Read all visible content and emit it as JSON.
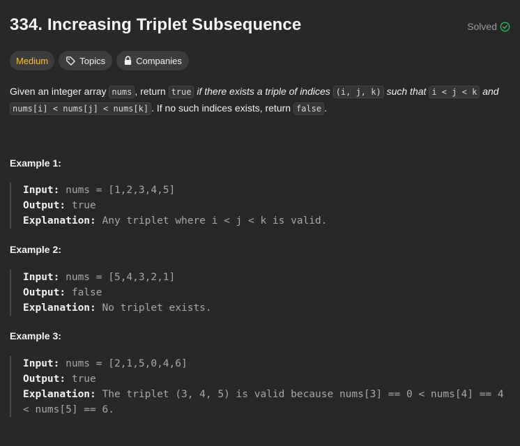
{
  "problem": {
    "title": "334. Increasing Triplet Subsequence",
    "status": "Solved",
    "status_color": "#2cbb5d"
  },
  "tags": {
    "difficulty": "Medium",
    "topics": "Topics",
    "companies": "Companies"
  },
  "description": {
    "p1": "Given an integer array ",
    "c1": "nums",
    "p2": ", return ",
    "c2": "true",
    "p3": " ",
    "i1": "if there exists a triple of indices",
    "p4": " ",
    "c3": "(i, j, k)",
    "p5": " ",
    "i2": "such that",
    "p6": " ",
    "c4": "i < j < k",
    "p7": " ",
    "i3": "and",
    "p8": " ",
    "c5": "nums[i] < nums[j] < nums[k]",
    "p9": ". If no such indices exists, return ",
    "c6": "false",
    "p10": "."
  },
  "labels": {
    "input": "Input:",
    "output": "Output:",
    "explanation": "Explanation:"
  },
  "examples": [
    {
      "title": "Example 1:",
      "input": " nums = [1,2,3,4,5]",
      "output": " true",
      "explanation": " Any triplet where i < j < k is valid."
    },
    {
      "title": "Example 2:",
      "input": " nums = [5,4,3,2,1]",
      "output": " false",
      "explanation": " No triplet exists."
    },
    {
      "title": "Example 3:",
      "input": " nums = [2,1,5,0,4,6]",
      "output": " true",
      "explanation": " The triplet (3, 4, 5) is valid because nums[3] == 0 < nums[4] == 4 < nums[5] == 6."
    }
  ]
}
